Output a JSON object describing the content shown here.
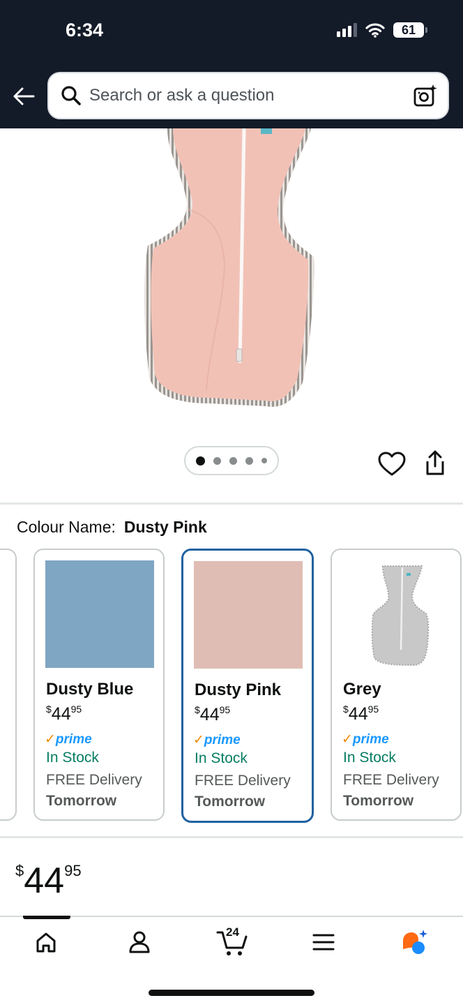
{
  "status_bar": {
    "time": "6:34",
    "battery": "61"
  },
  "search": {
    "placeholder": "Search or ask a question"
  },
  "product_image": {
    "carousel_total": 5,
    "carousel_active": 1
  },
  "colour": {
    "label": "Colour Name:",
    "selected": "Dusty Pink"
  },
  "swatches": [
    {
      "name": "Dusty Blue",
      "price_whole": "44",
      "price_fraction": "95",
      "currency": "$",
      "prime": "prime",
      "stock": "In Stock",
      "delivery": "FREE Delivery",
      "delivery_day": "Tomorrow",
      "color": "#7fa6c3"
    },
    {
      "name": "Dusty Pink",
      "price_whole": "44",
      "price_fraction": "95",
      "currency": "$",
      "prime": "prime",
      "stock": "In Stock",
      "delivery": "FREE Delivery",
      "delivery_day": "Tomorrow",
      "color": "#dfbdb4"
    },
    {
      "name": "Grey",
      "price_whole": "44",
      "price_fraction": "95",
      "currency": "$",
      "prime": "prime",
      "stock": "In Stock",
      "delivery": "FREE Delivery",
      "delivery_day": "Tomorrow",
      "color": "#d3d3d3"
    }
  ],
  "price": {
    "currency": "$",
    "whole": "44",
    "fraction": "95"
  },
  "bottom_nav": {
    "cart_count": "24",
    "items": [
      "home-icon",
      "account-icon",
      "cart-icon",
      "menu-icon",
      "rufus-icon"
    ]
  },
  "colors": {
    "header": "#131a28",
    "selected_border": "#2162a1",
    "stock": "#067d62",
    "prime": "#1a98ff"
  }
}
